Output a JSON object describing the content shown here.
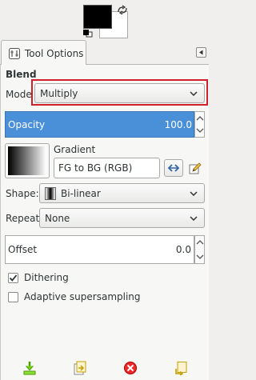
{
  "tab": {
    "label": "Tool Options"
  },
  "tool": {
    "title": "Blend"
  },
  "mode": {
    "label": "Mode",
    "value": "Multiply"
  },
  "opacity": {
    "label": "Opacity",
    "value": "100.0"
  },
  "gradient": {
    "label": "Gradient",
    "value": "FG to BG (RGB)"
  },
  "shape": {
    "label": "Shape:",
    "value": "Bi-linear"
  },
  "repeat": {
    "label": "Repeat:",
    "value": "None"
  },
  "offset": {
    "label": "Offset",
    "value": "0.0"
  },
  "dithering": {
    "label": "Dithering",
    "checked": true
  },
  "adaptive": {
    "label": "Adaptive supersampling",
    "checked": false
  },
  "colors": {
    "accent": "#4a90d9",
    "highlight_border": "#d0202a",
    "foreground_color": "#000000",
    "background_color": "#ffffff"
  },
  "icons": {
    "swap": "swap-colors-icon",
    "default_colors": "default-colors-icon",
    "tab": "tool-options-icon",
    "tab_menu": "tab-menu-icon",
    "reverse": "reverse-gradient-icon",
    "edit": "edit-gradient-icon",
    "save": "save-options-icon",
    "restore": "restore-options-icon",
    "delete": "delete-options-icon",
    "reset": "reset-options-icon"
  }
}
